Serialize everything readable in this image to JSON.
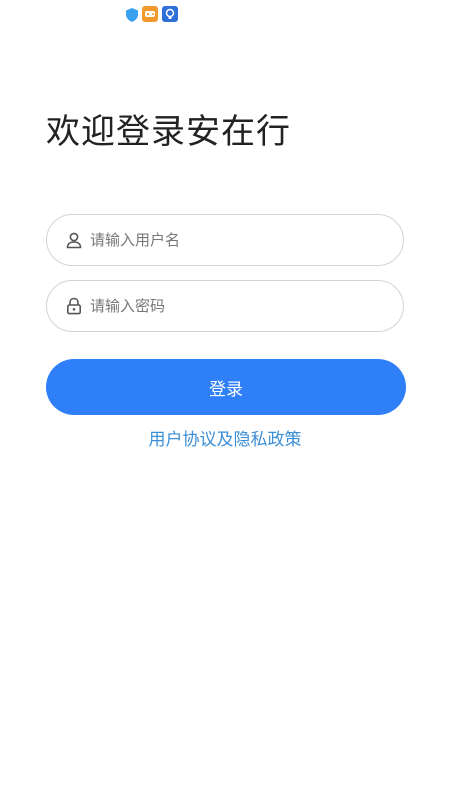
{
  "status_bar": {
    "icons": [
      "shield-icon",
      "game-icon",
      "bulb-icon"
    ]
  },
  "login": {
    "title": "欢迎登录安在行",
    "username": {
      "value": "",
      "placeholder": "请输入用户名",
      "icon": "user-icon"
    },
    "password": {
      "value": "",
      "placeholder": "请输入密码",
      "icon": "lock-icon"
    },
    "button_label": "登录",
    "agreement_link": "用户协议及隐私政策"
  },
  "colors": {
    "accent": "#2f80f8",
    "link": "#3b8fd6",
    "title_text": "#222222",
    "field_border": "#d3d3d3"
  }
}
